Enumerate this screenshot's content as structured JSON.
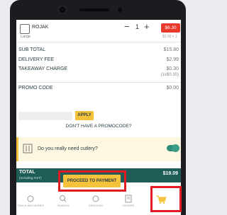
{
  "item": {
    "name": "ROJAK",
    "size": "Large",
    "quantity": "1",
    "price": "$6.30",
    "sub_price": "$2.60 x 1"
  },
  "summary": {
    "subtotal_label": "SUB TOTAL",
    "subtotal_value": "$15.80",
    "delivery_label": "DELIVERY FEE",
    "delivery_value": "$2.99",
    "takeaway_label": "TAKEAWAY CHARGE",
    "takeaway_value": "$0.30",
    "takeaway_note": "(1x$0.30)",
    "promo_label": "PROMO CODE",
    "promo_value": "$0.00",
    "apply_label": "APPLY",
    "no_promo_link": "DON'T HAVE A PROMOCODE?"
  },
  "cutlery": {
    "question": "Do you really need cutlery?",
    "enabled": true
  },
  "total": {
    "label": "TOTAL",
    "note": "(Including GST)",
    "amount": "$19.09"
  },
  "proceed_label": "PROCEED TO PAYMENT",
  "nav": [
    {
      "label": "TRACK DELIVERIES",
      "icon": "delivery-icon"
    },
    {
      "label": "SEARCH",
      "icon": "search-icon"
    },
    {
      "label": "SERVICES",
      "icon": "services-icon"
    },
    {
      "label": "ORDERS",
      "icon": "orders-icon"
    },
    {
      "label": "",
      "icon": "cart-icon"
    }
  ],
  "colors": {
    "accent_yellow": "#f5c23b",
    "total_bar": "#1e5c58",
    "price_badge": "#e8392c",
    "highlight_red": "#e11b22"
  }
}
